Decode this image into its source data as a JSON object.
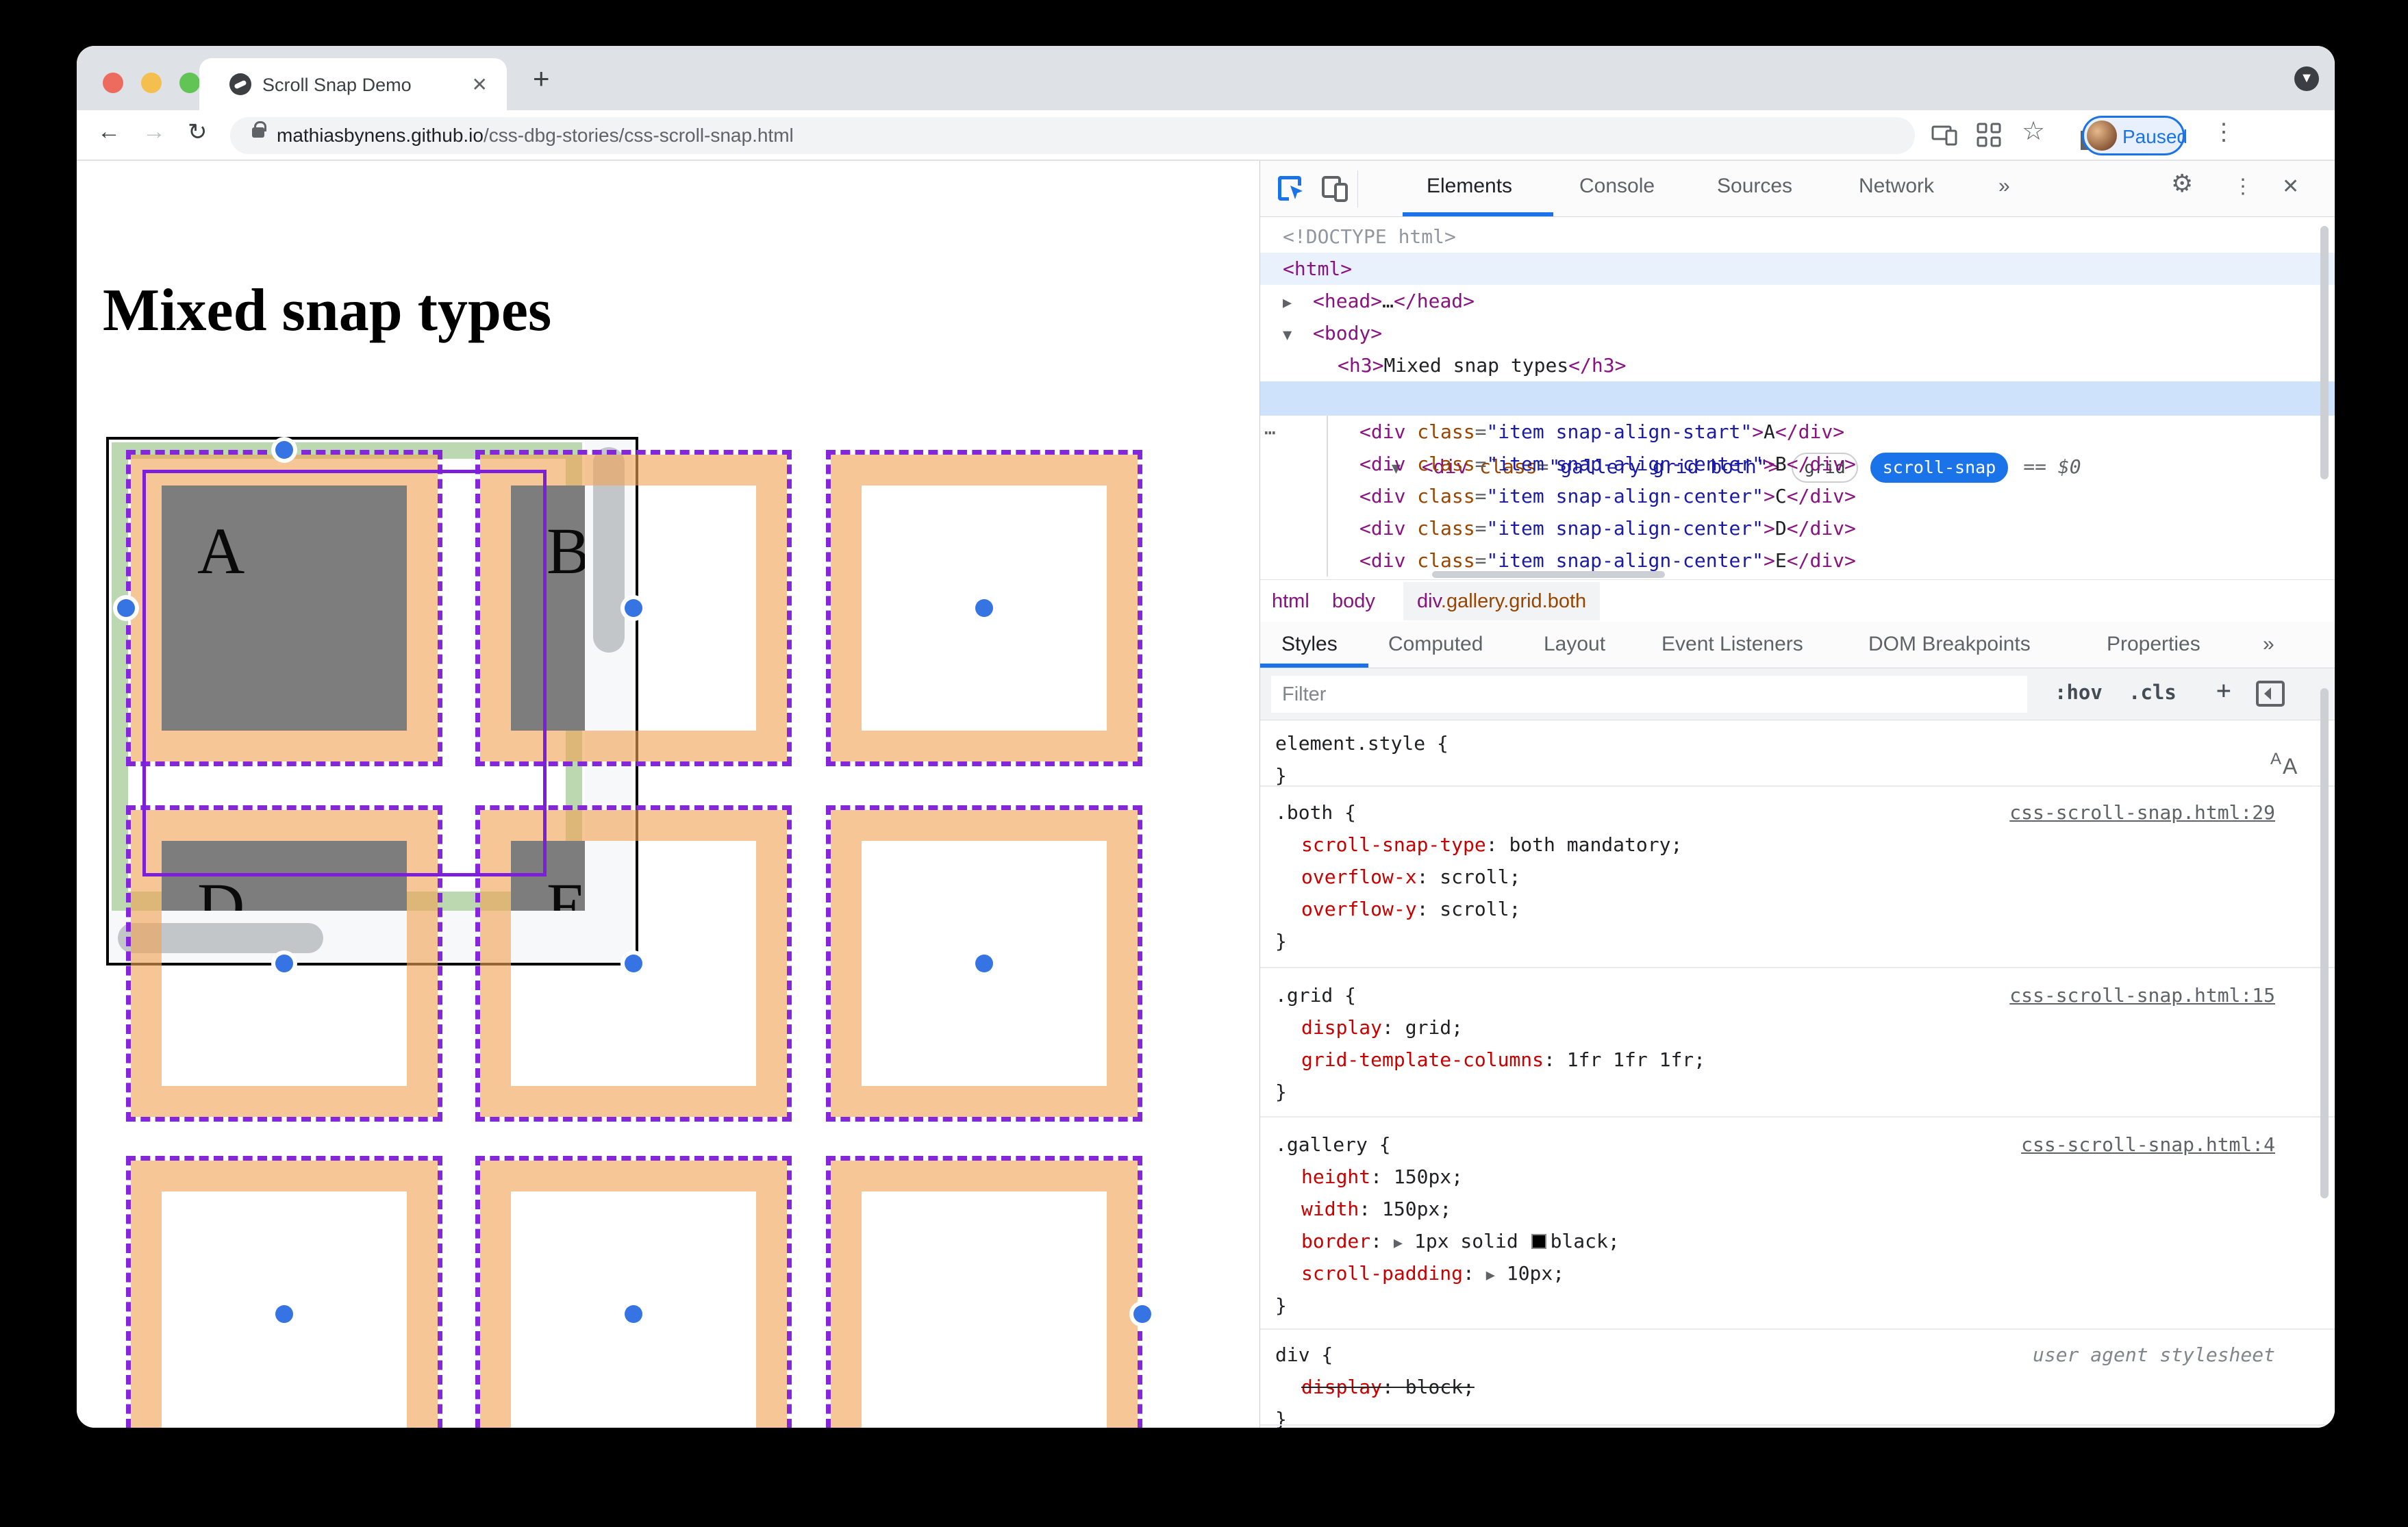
{
  "window": {
    "tab_title": "Scroll Snap Demo",
    "close_tab": "✕",
    "new_tab": "+",
    "url_host": "mathiasbynens.github.io",
    "url_path": "/css-dbg-stories/css-scroll-snap.html",
    "paused_label": "Paused",
    "back": "←",
    "forward": "→",
    "reload": "↻",
    "star": "☆",
    "menu_dots": "⋮",
    "chev_down": "▼"
  },
  "page": {
    "heading": "Mixed snap types",
    "letters": {
      "a": "A",
      "b": "B",
      "d": "D",
      "e": "E"
    },
    "colors": {
      "snap_area_dash": "#8426d9",
      "scroll_margin_orange": "#f1a356",
      "scroll_padding_green": "#bcd8b0",
      "item_gray": "#7d7d7d",
      "snap_point_blue": "#3574e2",
      "grid_overlay_purple": "#7d1fd8"
    }
  },
  "devtools": {
    "tabs": {
      "elements": "Elements",
      "console": "Console",
      "sources": "Sources",
      "network": "Network",
      "more": "»"
    },
    "sx": {
      "ob": " {",
      "cb": "}",
      "cs": ": ",
      "sc": ";",
      "exp": "▼",
      "col": "▶",
      "dots": "⋯",
      "gear": "⚙",
      "menu": "⋮",
      "close": "✕",
      "eqdollar": "== $0"
    },
    "dom": {
      "doctype": "<!DOCTYPE html>",
      "html_open": "<html>",
      "head": {
        "t1": "<head>",
        "d": "…",
        "t2": "</head>"
      },
      "body_open": "<body>",
      "h3": {
        "t1": "<h3>",
        "x": "Mixed snap types",
        "t2": "</h3>"
      },
      "gallery": {
        "t1": "<div ",
        "t2": "class",
        "t3": "=",
        "t4": "\"gallery grid both\"",
        "t5": ">",
        "badge_grid": "grid",
        "badge_snap": "scroll-snap"
      },
      "items": [
        {
          "t1": "<div ",
          "t2": "class",
          "t3": "=",
          "t4": "\"item snap-align-start\"",
          "t5": ">",
          "t6": "A",
          "t7": "</div>"
        },
        {
          "t1": "<div ",
          "t2": "class",
          "t3": "=",
          "t4": "\"item snap-align-center\"",
          "t5": ">",
          "t6": "B",
          "t7": "</div>"
        },
        {
          "t1": "<div ",
          "t2": "class",
          "t3": "=",
          "t4": "\"item snap-align-center\"",
          "t5": ">",
          "t6": "C",
          "t7": "</div>"
        },
        {
          "t1": "<div ",
          "t2": "class",
          "t3": "=",
          "t4": "\"item snap-align-center\"",
          "t5": ">",
          "t6": "D",
          "t7": "</div>"
        },
        {
          "t1": "<div ",
          "t2": "class",
          "t3": "=",
          "t4": "\"item snap-align-center\"",
          "t5": ">",
          "t6": "E",
          "t7": "</div>"
        }
      ]
    },
    "breadcrumb": {
      "html": "html",
      "body": "body",
      "sel_tag": "div",
      "sel_cls": ".gallery.grid.both"
    },
    "sidebar_tabs": {
      "styles": "Styles",
      "computed": "Computed",
      "layout": "Layout",
      "events": "Event Listeners",
      "dombp": "DOM Breakpoints",
      "props": "Properties",
      "more": "»"
    },
    "filter": {
      "placeholder": "Filter",
      "hov": ":hov",
      "cls": ".cls",
      "plus": "+"
    },
    "rules": [
      {
        "selector": "element.style",
        "link": ""
      },
      {
        "selector": ".both",
        "link": "css-scroll-snap.html:29",
        "props": [
          {
            "n": "scroll-snap-type",
            "v": "both mandatory"
          },
          {
            "n": "overflow-x",
            "v": "scroll"
          },
          {
            "n": "overflow-y",
            "v": "scroll"
          }
        ]
      },
      {
        "selector": ".grid",
        "link": "css-scroll-snap.html:15",
        "props": [
          {
            "n": "display",
            "v": "grid"
          },
          {
            "n": "grid-template-columns",
            "v": "1fr 1fr 1fr"
          }
        ]
      },
      {
        "selector": ".gallery",
        "link": "css-scroll-snap.html:4",
        "props": [
          {
            "n": "height",
            "v": "150px"
          },
          {
            "n": "width",
            "v": "150px"
          },
          {
            "n": "border",
            "v1": "1px solid ",
            "v2": "black"
          },
          {
            "n": "scroll-padding",
            "v": "10px"
          }
        ]
      },
      {
        "selector": "div",
        "link": "user agent stylesheet",
        "props": [
          {
            "n": "display",
            "v": "block"
          }
        ]
      }
    ]
  }
}
